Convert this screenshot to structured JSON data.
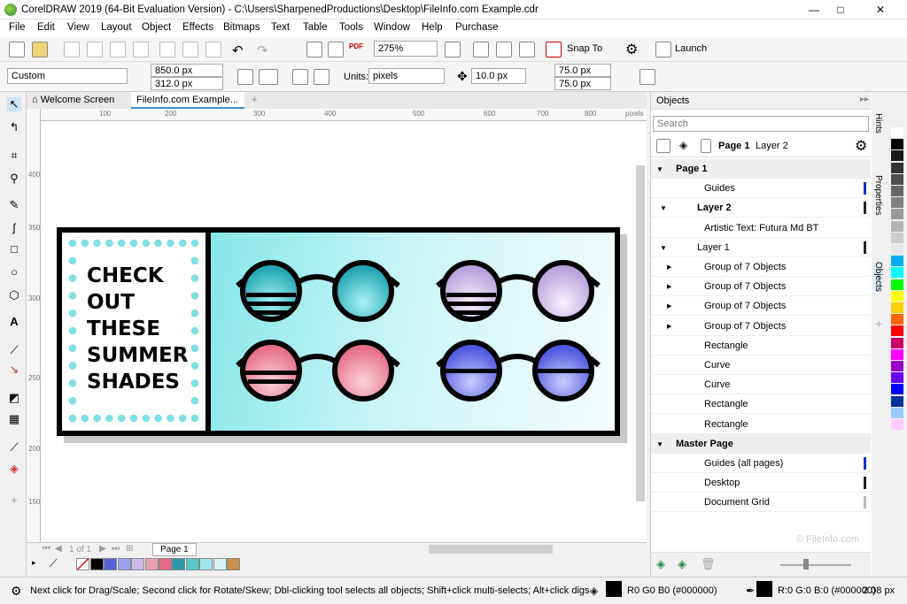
{
  "title_bar": {
    "title": "CorelDRAW 2019 (64-Bit Evaluation Version) - C:\\Users\\SharpenedProductions\\Desktop\\FileInfo.com Example.cdr",
    "minimize": "—",
    "maximize": "□",
    "close": "✕"
  },
  "menu": [
    "File",
    "Edit",
    "View",
    "Layout",
    "Object",
    "Effects",
    "Bitmaps",
    "Text",
    "Table",
    "Tools",
    "Window",
    "Help",
    "Purchase"
  ],
  "standard_toolbar": {
    "zoom": "275%",
    "snap_to": "Snap To",
    "launch": "Launch",
    "pdf": "PDF"
  },
  "property_bar": {
    "preset": "Custom",
    "width": "850.0 px",
    "height": "312.0 px",
    "units_label": "Units:",
    "units": "pixels",
    "nudge": "10.0 px",
    "dup_x": "75.0 px",
    "dup_y": "75.0 px"
  },
  "doc_tabs": {
    "welcome": "Welcome Screen",
    "file": "FileInfo.com Example...",
    "add": "+"
  },
  "ruler": {
    "top_labels": [
      "100",
      "200",
      "300",
      "400",
      "500",
      "600",
      "700",
      "800"
    ],
    "unit": "pixels",
    "left_labels": [
      "400",
      "350",
      "300",
      "250",
      "200",
      "150"
    ]
  },
  "artwork": {
    "headline": [
      "CHECK",
      "OUT",
      "THESE",
      "SUMMER",
      "SHADES"
    ]
  },
  "page_nav": {
    "page_count": "1 of 1",
    "page_tab": "Page 1"
  },
  "color_bar": {
    "swatches": [
      "#000000",
      "#5561d8",
      "#9aa2ee",
      "#cdb8e8",
      "#e7a1b3",
      "#e36a87",
      "#2a9aa8",
      "#56c8cc",
      "#9fe7ea",
      "#d6f3f4",
      "#c98e49"
    ]
  },
  "status": {
    "hint": "Next click for Drag/Scale; Second click for Rotate/Skew; Dbl-clicking tool selects all objects; Shift+click multi-selects; Alt+click digs",
    "fill": "R0 G0 B0 (#000000)",
    "outline": "R:0 G:0 B:0 (#000000)",
    "outline_width": "2.08 px"
  },
  "objects_panel": {
    "title": "Objects",
    "search_placeholder": "Search",
    "page_label": "Page 1",
    "layer_label": "Layer 2",
    "rows": [
      {
        "text": "Page 1",
        "type": "header"
      },
      {
        "text": "Guides",
        "type": "item"
      },
      {
        "text": "Layer 2",
        "type": "layer"
      },
      {
        "text": "Artistic Text: Futura Md BT",
        "type": "child"
      },
      {
        "text": "Layer 1",
        "type": "layer"
      },
      {
        "text": "Group of 7 Objects",
        "type": "child"
      },
      {
        "text": "Group of 7 Objects",
        "type": "child"
      },
      {
        "text": "Group of 7 Objects",
        "type": "child"
      },
      {
        "text": "Group of 7 Objects",
        "type": "child"
      },
      {
        "text": "Rectangle",
        "type": "child"
      },
      {
        "text": "Curve",
        "type": "child"
      },
      {
        "text": "Curve",
        "type": "child"
      },
      {
        "text": "Rectangle",
        "type": "child"
      },
      {
        "text": "Rectangle",
        "type": "child"
      },
      {
        "text": "Master Page",
        "type": "header"
      },
      {
        "text": "Guides (all pages)",
        "type": "item"
      },
      {
        "text": "Desktop",
        "type": "item"
      },
      {
        "text": "Document Grid",
        "type": "item"
      }
    ],
    "watermark": "© FileInfo.com"
  },
  "docker_tabs": [
    "Hints",
    "Properties",
    "Objects"
  ],
  "right_palette": [
    "#ffffff",
    "#000000",
    "#1a1a1a",
    "#333333",
    "#4d4d4d",
    "#666666",
    "#808080",
    "#999999",
    "#b3b3b3",
    "#cccccc",
    "#e6e6e6",
    "#00aeef",
    "#00ffff",
    "#00ff00",
    "#ffff00",
    "#ffcc00",
    "#ff6600",
    "#ff0000",
    "#cc0066",
    "#ff00ff",
    "#9900cc",
    "#6600ff",
    "#0000ff",
    "#003399",
    "#99ccff",
    "#ffccff"
  ]
}
